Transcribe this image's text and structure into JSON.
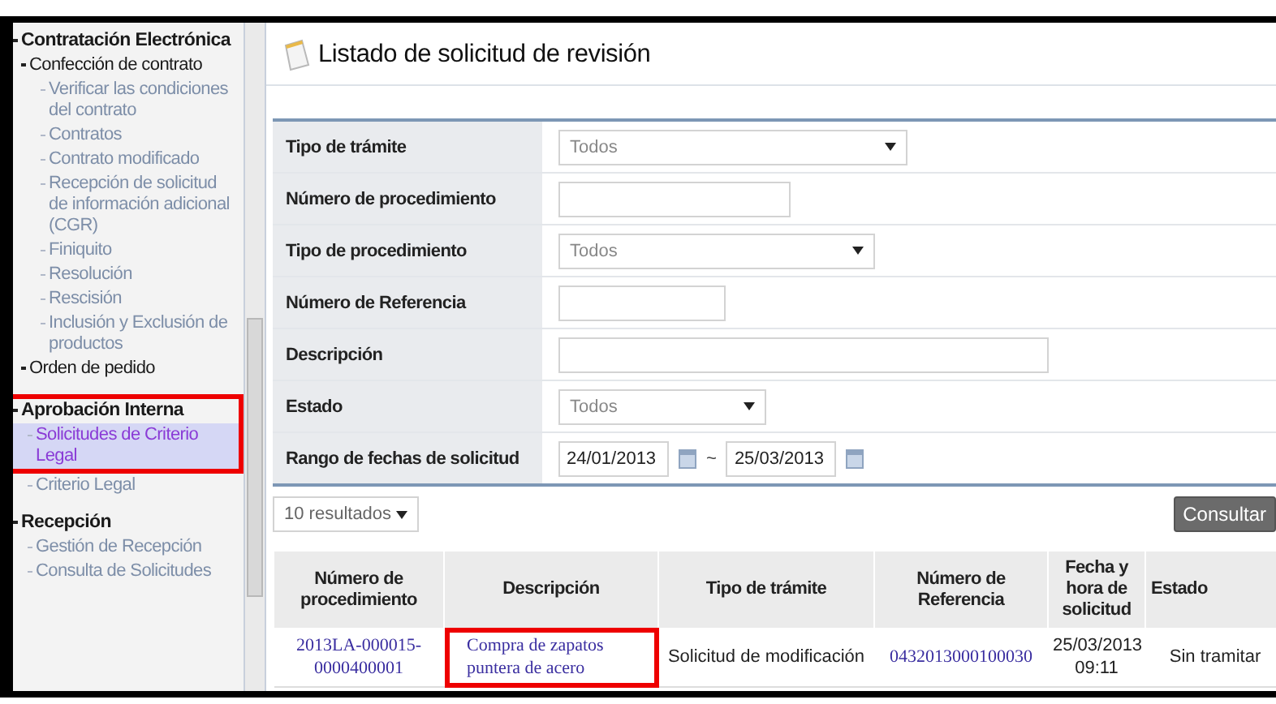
{
  "sidebar": {
    "sections": [
      {
        "label": "Contratación Electrónica",
        "highlighted": false,
        "children": [
          {
            "label": "Confección de contrato",
            "kind": "group",
            "highlighted": false,
            "selected": false,
            "children": [
              {
                "label": "Verificar las condiciones del contrato",
                "kind": "link",
                "highlighted": false,
                "selected": false
              },
              {
                "label": "Contratos",
                "kind": "link",
                "highlighted": false,
                "selected": false
              },
              {
                "label": "Contrato modificado",
                "kind": "link",
                "highlighted": false,
                "selected": false
              },
              {
                "label": "Recepción de solicitud de información adicional (CGR)",
                "kind": "link",
                "highlighted": false,
                "selected": false
              },
              {
                "label": "Finiquito",
                "kind": "link",
                "highlighted": false,
                "selected": false
              },
              {
                "label": "Resolución",
                "kind": "link",
                "highlighted": false,
                "selected": false
              },
              {
                "label": "Rescisión",
                "kind": "link",
                "highlighted": false,
                "selected": false
              },
              {
                "label": "Inclusión y Exclusión de productos",
                "kind": "link",
                "highlighted": false,
                "selected": false
              }
            ]
          },
          {
            "label": "Orden de pedido",
            "kind": "group",
            "highlighted": false,
            "selected": false
          }
        ]
      },
      {
        "label": "Aprobación Interna",
        "highlighted": true,
        "children": [
          {
            "label": "Solicitudes de Criterio Legal",
            "kind": "link",
            "highlighted": true,
            "selected": true
          },
          {
            "label": "Criterio Legal",
            "kind": "link",
            "highlighted": false,
            "selected": false
          }
        ]
      },
      {
        "label": "Recepción",
        "highlighted": false,
        "children": [
          {
            "label": "Gestión de Recepción",
            "kind": "link",
            "highlighted": false,
            "selected": false
          },
          {
            "label": "Consulta de Solicitudes",
            "kind": "link",
            "highlighted": false,
            "selected": false
          }
        ]
      }
    ]
  },
  "page": {
    "title": "Listado de solicitud de revisión"
  },
  "form": {
    "fields": [
      {
        "label": "Tipo de trámite",
        "kind": "select",
        "value": "Todos"
      },
      {
        "label": "Número de procedimiento",
        "kind": "text"
      },
      {
        "label": "Tipo de procedimiento",
        "kind": "select",
        "value": "Todos"
      },
      {
        "label": "Número de Referencia",
        "kind": "text"
      },
      {
        "label": "Descripción",
        "kind": "text"
      },
      {
        "label": "Estado",
        "kind": "select",
        "value": "Todos"
      },
      {
        "label": "Rango de fechas de solicitud",
        "kind": "daterange",
        "from": "24/01/2013",
        "separator": "~",
        "to": "25/03/2013"
      }
    ]
  },
  "page_size": {
    "value": "10 resultados"
  },
  "search_button": {
    "label": "Consultar"
  },
  "table": {
    "columns": [
      "Número de procedimiento",
      "Descripción",
      "Tipo de trámite",
      "Número de Referencia",
      "Fecha y hora de solicitud",
      "Estado"
    ],
    "rows": [
      {
        "cells": [
          {
            "text": "2013LA-000015-0000400001",
            "kind": "link",
            "highlighted": false
          },
          {
            "text": "Compra de zapatos puntera de acero",
            "kind": "link",
            "highlighted": true
          },
          {
            "text": "Solicitud de modificación",
            "kind": "plain",
            "highlighted": false
          },
          {
            "text": "0432013000100030",
            "kind": "link",
            "highlighted": false
          },
          {
            "text": "25/03/2013 09:11",
            "kind": "plain",
            "highlighted": false
          },
          {
            "text": "Sin tramitar",
            "kind": "plain",
            "highlighted": false
          }
        ]
      }
    ]
  }
}
